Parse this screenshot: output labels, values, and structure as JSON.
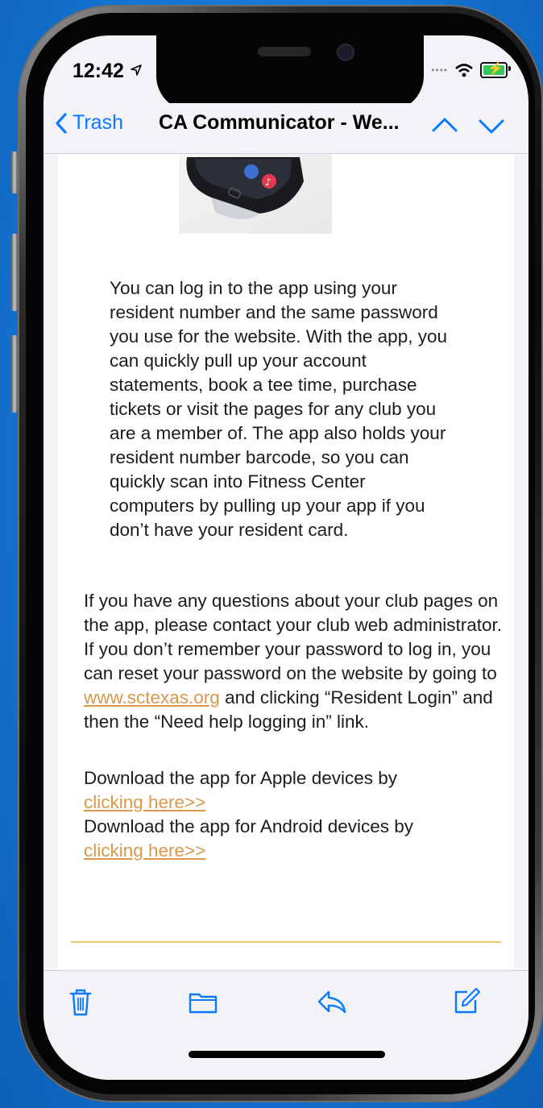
{
  "status": {
    "time": "12:42",
    "battery_charging": true
  },
  "navbar": {
    "back_label": "Trash",
    "title": "CA Communicator - We..."
  },
  "body": {
    "para1": "You can log in to the app using your resident number and the same password you use for the website. With the app, you can quickly pull up your account statements, book a tee time, purchase tickets or visit the pages for any club you are a member of. The app also holds your resident number barcode, so you can quickly scan into Fitness Center computers by pulling up your app if you don’t have your resident card.",
    "para2_a": "If you have any questions about your club pages on the app, please contact your club web administrator. If you don’t remember your password to log in, you can reset your password on the website by going to",
    "para2_link": "www.sctexas.org",
    "para2_b": "and clicking “Resident Login” and then the “Need help logging in” link.",
    "apple_text": "Download the app for Apple devices by",
    "apple_link": "clicking here>>",
    "android_text": "Download the app for Android devices by",
    "android_link": "clicking here>>"
  },
  "toolbar": {
    "icons": [
      "trash-icon",
      "folder-icon",
      "reply-icon",
      "compose-icon"
    ]
  },
  "colors": {
    "accent": "#0a7aff",
    "link": "#d9984a",
    "divider": "#f1c96b"
  }
}
